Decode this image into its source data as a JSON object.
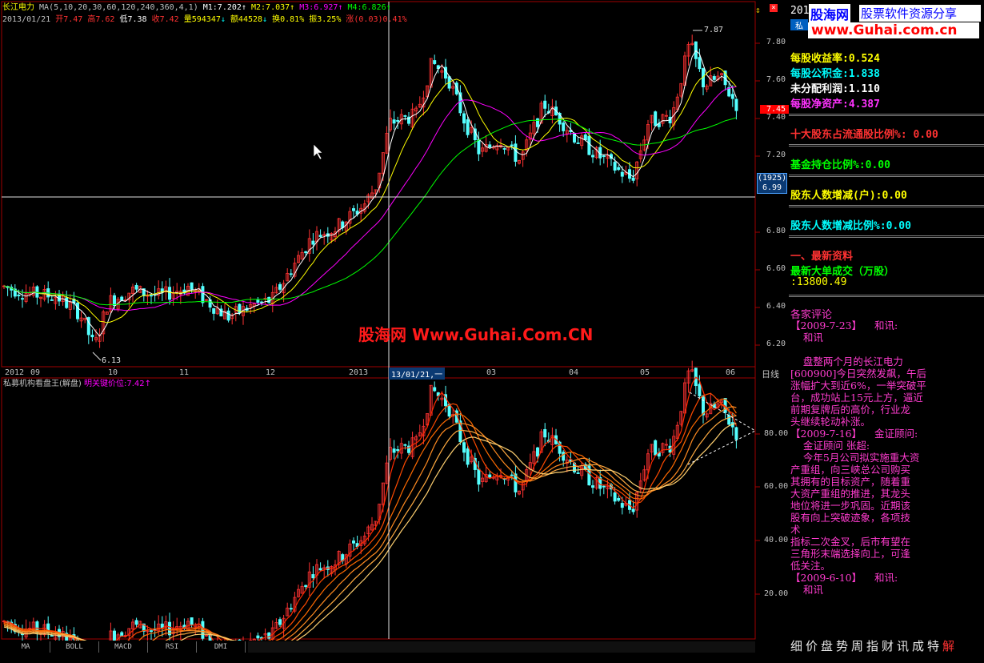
{
  "header": {
    "stock_name": "长江电力",
    "ma_params": "MA(5,10,20,30,60,120,240,360,4,1)",
    "m1": "M1:7.202",
    "m2": "M2:7.037",
    "m3": "M3:6.927",
    "m4": "M4:6.826",
    "date": "2013/01/21",
    "open": "开7.47",
    "high": "高7.62",
    "low": "低7.38",
    "close": "收7.42",
    "volume": "量594347",
    "amount": "额44528",
    "turnover": "换0.81%",
    "amplitude": "振3.25%",
    "change": "涨(0.03)0.41%"
  },
  "price_axis": [
    "7.80",
    "7.60",
    "7.40",
    "7.20",
    "6.80",
    "6.60",
    "6.40",
    "6.20"
  ],
  "price_current": "7.45",
  "cursor_box": {
    "count": "(1925)",
    "price": "6.99"
  },
  "marks": {
    "high": "7.87",
    "low": "6.13"
  },
  "time_axis": [
    "2012",
    "09",
    "10",
    "11",
    "12",
    "2013",
    "03",
    "04",
    "05",
    "06"
  ],
  "cursor_date": "13/01/21,一",
  "period": "日线",
  "watermark": "股海网 Www.Guhai.Com.CN",
  "indicator": {
    "name": "私募机构看盘王(解盘)",
    "key_price": "明关键价位:7.42",
    "axis": [
      "80.00",
      "60.00",
      "40.00",
      "20.00"
    ]
  },
  "tabs": [
    "MA",
    "BOLL",
    "MACD",
    "RSI",
    "DMI"
  ],
  "panel": {
    "top_digits": "201",
    "logo": "股海网",
    "slogan": "股票软件资源分享",
    "url": "www.Guhai.com.cn",
    "eps": "每股收益率:0.524",
    "reserve": "每股公积金:1.838",
    "undistributed": "未分配利润:1.110",
    "nav": "每股净资产:4.387",
    "top10": "十大股东占流通股比例%: 0.00",
    "fund": "基金持仓比例%:0.00",
    "holders_change": "股东人数增减(户):0.00",
    "holders_ratio": "股东人数增减比例%:0.00",
    "latest_title": "一、最新资料",
    "big_order_title": "最新大单成交（万股）",
    "big_order_value": ":13800.49",
    "comments_title": "各家评论",
    "news": "【2009-7-23】    和讯:\n    和讯\n\n    盘整两个月的长江电力\n[600900]今日突然发飙，午后\n涨幅扩大到近6%，一举突破平\n台，成功站上15元上方，逼近\n前期复牌后的高价，行业龙\n头继续轮动补涨。\n【2009-7-16】    金证顾问:\n    金证顾问 张超:\n    今年5月公司拟实施重大资\n产重组，向三峡总公司购买\n其拥有的目标资产，随着重\n大资产重组的推进，其龙头\n地位将进一步巩固。近期该\n股有向上突破迹象，各项技\n术\n指标二次金叉，后市有望在\n三角形末端选择向上，可逢\n低关注。\n【2009-6-10】    和讯:\n    和讯"
  },
  "bottom_nav": [
    "细",
    "价",
    "盘",
    "势",
    "周",
    "指",
    "财",
    "讯",
    "成",
    "特",
    "解"
  ],
  "colors": {
    "up": "#ff3232",
    "down": "#54ffff",
    "ma1": "#ffffff",
    "ma2": "#ffff00",
    "ma3": "#ff00ff",
    "ma4": "#00ff00",
    "grid": "#8b0000"
  }
}
